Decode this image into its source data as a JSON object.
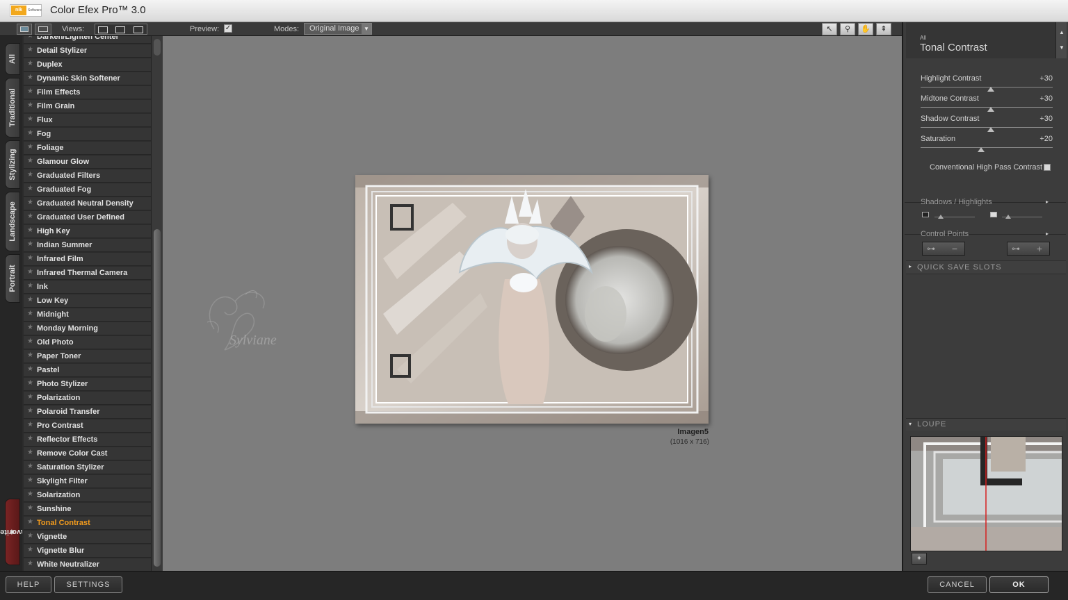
{
  "app": {
    "title": "Color Efex Pro™ 3.0",
    "logo_text": "nik",
    "logo_sub": "Software"
  },
  "toolbar": {
    "views_label": "Views:",
    "preview_label": "Preview:",
    "preview_checked": "✓",
    "modes_label": "Modes:",
    "modes_value": "Original Image"
  },
  "categories": [
    "All",
    "Traditional",
    "Stylizing",
    "Landscape",
    "Portrait",
    "Favorites"
  ],
  "filters": [
    "Darken/Lighten Center",
    "Detail Stylizer",
    "Duplex",
    "Dynamic Skin Softener",
    "Film Effects",
    "Film Grain",
    "Flux",
    "Fog",
    "Foliage",
    "Glamour Glow",
    "Graduated Filters",
    "Graduated Fog",
    "Graduated Neutral Density",
    "Graduated User Defined",
    "High Key",
    "Indian Summer",
    "Infrared Film",
    "Infrared Thermal Camera",
    "Ink",
    "Low Key",
    "Midnight",
    "Monday Morning",
    "Old Photo",
    "Paper Toner",
    "Pastel",
    "Photo Stylizer",
    "Polarization",
    "Polaroid Transfer",
    "Pro Contrast",
    "Reflector Effects",
    "Remove Color Cast",
    "Saturation Stylizer",
    "Skylight Filter",
    "Solarization",
    "Sunshine",
    "Tonal Contrast",
    "Vignette",
    "Vignette Blur",
    "White Neutralizer"
  ],
  "selected_filter": "Tonal Contrast",
  "canvas": {
    "watermark_text": "Sylviane",
    "image_name": "Imagen5",
    "image_size": "(1016 x 716)"
  },
  "panel": {
    "category": "All",
    "title": "Tonal Contrast",
    "sliders": [
      {
        "label": "Highlight Contrast",
        "value": "+30",
        "level": 0.53
      },
      {
        "label": "Midtone Contrast",
        "value": "+30",
        "level": 0.53
      },
      {
        "label": "Shadow Contrast",
        "value": "+30",
        "level": 0.53
      },
      {
        "label": "Saturation",
        "value": "+20",
        "level": 0.46
      }
    ],
    "conventional_high_pass": "Conventional High Pass Contrast",
    "shadows_highlights": "Shadows / Highlights",
    "control_points": "Control Points",
    "quick_save": "QUICK SAVE SLOTS",
    "loupe": "LOUPE"
  },
  "bottom": {
    "help": "HELP",
    "settings": "SETTINGS",
    "cancel": "CANCEL",
    "ok": "OK"
  },
  "colors": {
    "accent": "#f29b1d",
    "favorites_tab": "#7a2424",
    "canvas_bg": "#7d7d7d"
  }
}
